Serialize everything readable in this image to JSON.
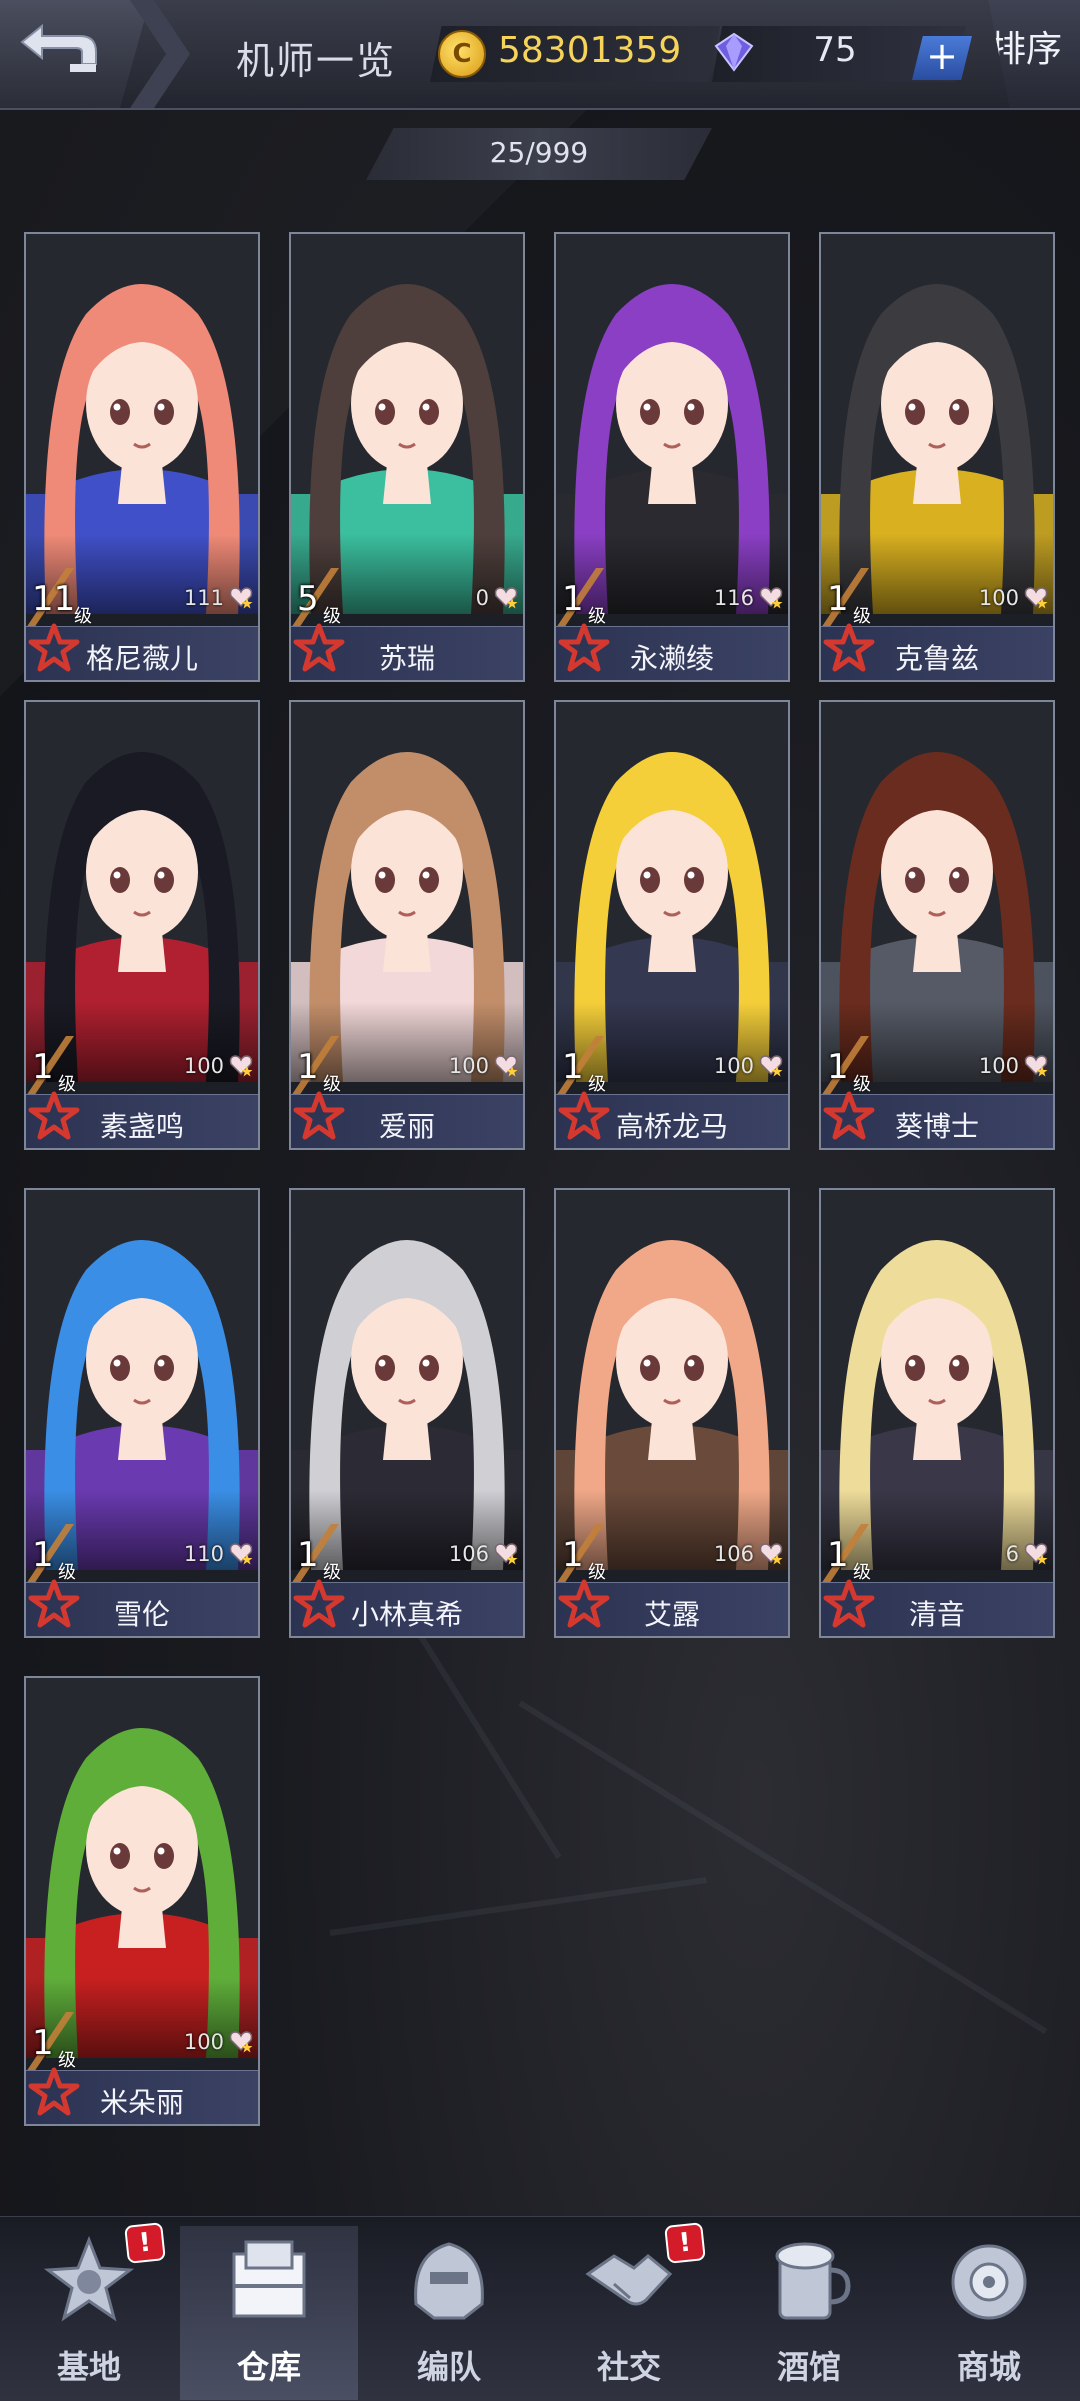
{
  "header": {
    "title": "机师一览",
    "coins": "58301359",
    "gems": "75",
    "plus_label": "+",
    "sort_label": "排序"
  },
  "roster_count": "25/999",
  "level_unit": "级",
  "pilots": [
    {
      "name": "格尼薇儿",
      "level": "11",
      "fav": "111",
      "hair": "#f08a78",
      "accent": "#4050c8"
    },
    {
      "name": "苏瑞",
      "level": "5",
      "fav": "0",
      "hair": "#4e3f3c",
      "accent": "#3bbf9e"
    },
    {
      "name": "永濑绫",
      "level": "1",
      "fav": "116",
      "hair": "#8a3fc4",
      "accent": "#2a2a30"
    },
    {
      "name": "克鲁兹",
      "level": "1",
      "fav": "100",
      "hair": "#3c3c40",
      "accent": "#d8b020"
    },
    {
      "name": "素盏鸣",
      "level": "1",
      "fav": "100",
      "hair": "#1a1a24",
      "accent": "#b02030"
    },
    {
      "name": "爱丽",
      "level": "1",
      "fav": "100",
      "hair": "#c28e6a",
      "accent": "#f2d8d8"
    },
    {
      "name": "高桥龙马",
      "level": "1",
      "fav": "100",
      "hair": "#f5cf3a",
      "accent": "#343850"
    },
    {
      "name": "葵博士",
      "level": "1",
      "fav": "100",
      "hair": "#6a2c1e",
      "accent": "#555a66"
    },
    {
      "name": "雪伦",
      "level": "1",
      "fav": "110",
      "hair": "#3a8ee6",
      "accent": "#6a3ab0"
    },
    {
      "name": "小林真希",
      "level": "1",
      "fav": "106",
      "hair": "#cfcfd4",
      "accent": "#2c2a34"
    },
    {
      "name": "艾露",
      "level": "1",
      "fav": "106",
      "hair": "#f0a888",
      "accent": "#6a4a3a"
    },
    {
      "name": "清音",
      "level": "1",
      "fav": "6",
      "hair": "#eedc9a",
      "accent": "#3a3848"
    },
    {
      "name": "米朵丽",
      "level": "1",
      "fav": "100",
      "hair": "#5fae3a",
      "accent": "#c82020"
    }
  ],
  "nav": [
    {
      "label": "基地",
      "icon": "base-icon",
      "alert": "!"
    },
    {
      "label": "仓库",
      "icon": "warehouse-icon",
      "active": true
    },
    {
      "label": "编队",
      "icon": "mech-helmet-icon"
    },
    {
      "label": "社交",
      "icon": "handshake-icon",
      "alert": "!"
    },
    {
      "label": "酒馆",
      "icon": "tavern-icon"
    },
    {
      "label": "商城",
      "icon": "shop-icon"
    }
  ]
}
